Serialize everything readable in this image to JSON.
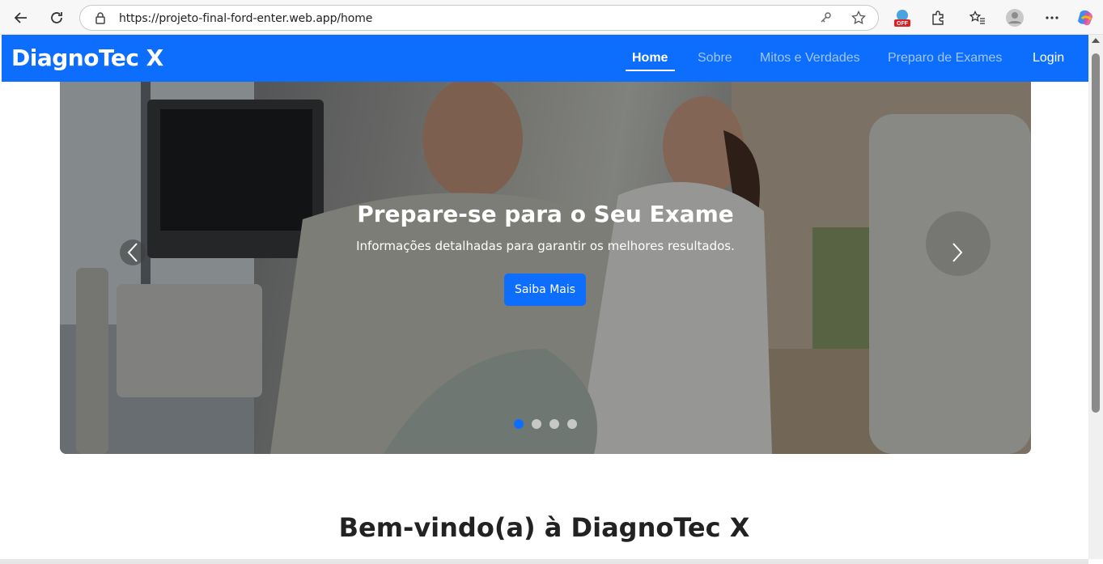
{
  "browser": {
    "url": "https://projeto-final-ford-enter.web.app/home",
    "extension_badge": "OFF"
  },
  "navbar": {
    "brand": "DiagnoTec X",
    "links": [
      {
        "label": "Home",
        "active": true
      },
      {
        "label": "Sobre",
        "active": false
      },
      {
        "label": "Mitos e Verdades",
        "active": false
      },
      {
        "label": "Preparo de Exames",
        "active": false
      }
    ],
    "login_label": "Login",
    "color": "#0d6efd"
  },
  "carousel": {
    "title": "Prepare-se para o Seu Exame",
    "subtitle": "Informações detalhadas para garantir os melhores resultados.",
    "cta_label": "Saiba Mais",
    "slide_count": 4,
    "active_slide": 1
  },
  "main": {
    "welcome_heading": "Bem-vindo(a) à DiagnoTec X"
  }
}
